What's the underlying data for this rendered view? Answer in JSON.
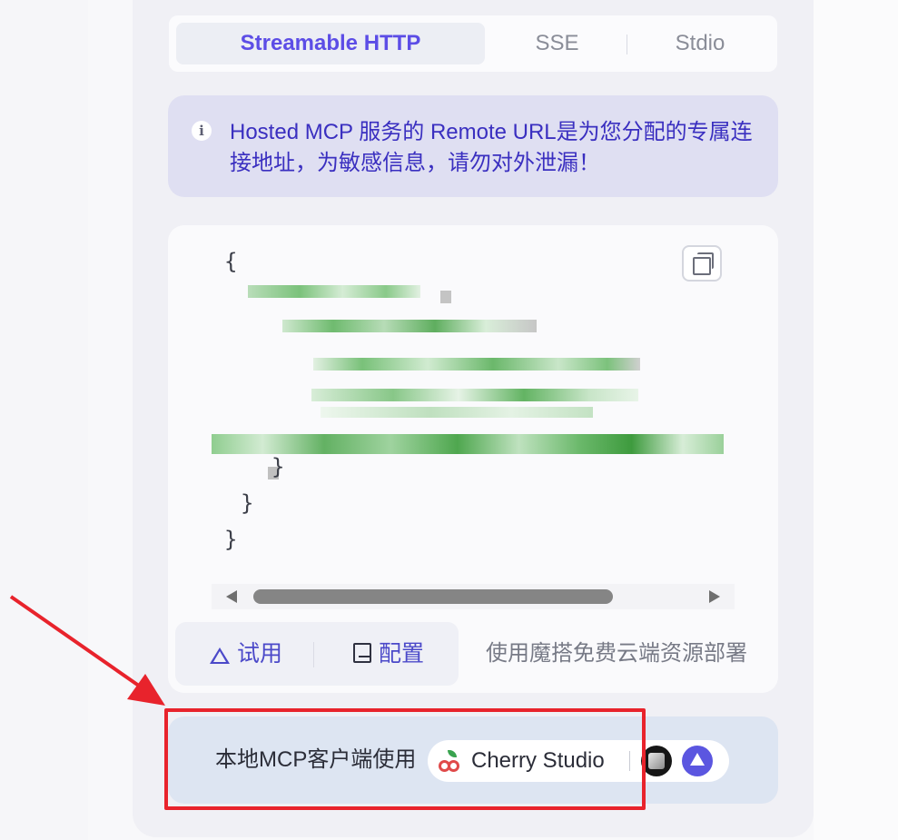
{
  "tabs": {
    "items": [
      {
        "label": "Streamable HTTP",
        "active": true
      },
      {
        "label": "SSE",
        "active": false
      },
      {
        "label": "Stdio",
        "active": false
      }
    ]
  },
  "alert": {
    "icon": "info-icon",
    "text": "Hosted MCP 服务的 Remote URL是为您分配的专属连接地址，为敏感信息，请勿对外泄漏！"
  },
  "code": {
    "visible_lines": [
      "{",
      "}",
      "}",
      "}"
    ],
    "content_blurred": true,
    "copy_icon": "copy-icon"
  },
  "actions": {
    "try_label": "试用",
    "config_label": "配置",
    "deploy_text": "使用魔搭免费云端资源部署"
  },
  "local": {
    "label": "本地MCP客户端使用",
    "client_name": "Cherry Studio"
  },
  "colors": {
    "accent": "#5c4de6",
    "alert_bg": "#dfdff2",
    "alert_text": "#3a2fc0",
    "highlight": "#e8232c",
    "local_bg": "#dde5f2"
  }
}
